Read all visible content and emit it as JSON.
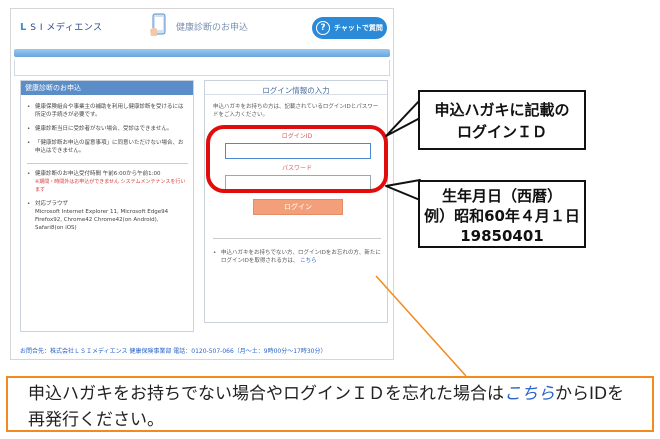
{
  "header": {
    "logo_mark": "L",
    "logo_text": "S I メディエンス",
    "page_title": "健康診断のお申込",
    "chat_icon": "?",
    "chat_label": "チャットで質問"
  },
  "left_panel": {
    "title": "健康診断のお申込",
    "items": [
      "健康保険組合や事業主の補助を利用し健康診断を受けるには所定の手続きが必要です。",
      "健康診断当日に受診者がない場合、受診はできません。",
      "「健康診断お申込の留意事項」に同意いただけない場合、お申込はできません。"
    ],
    "hours": "健康診断のお申込受付時間 午前6:00から午前1:00",
    "hours_note": "※期間・時間外はお申込ができません システムメンテナンスを行います",
    "browser_title": "対応ブラウザ",
    "browsers": "Microsoft Internet Explorer 11, Microsoft Edge94 Firefox92, Chrome42 Chrome42(on Android), Safari8(on iOS)"
  },
  "login_panel": {
    "title": "ログイン情報の入力",
    "description": "申込ハガキをお持ちの方は、記載されているログインIDとパスワードをご入力ください。",
    "login_id_label": "ログインID",
    "login_id_value": "",
    "password_label": "パスワード",
    "password_value": "",
    "login_button": "ログイン",
    "note_text": "申込ハガキをお持ちでない方、ログインIDをお忘れの方、新たにログインIDを取得される方は、",
    "note_link": "こちら"
  },
  "footer": {
    "contact": "お問合先：株式会社ＬＳＩメディエンス 健康保険事業部 電話：0120-507-066（月〜土：9時00分〜17時30分）"
  },
  "callouts": {
    "login_id": [
      "申込ハガキに記載の",
      "ログインＩＤ"
    ],
    "password": [
      "生年月日（西暦）",
      "例）昭和60年４月１日",
      "19850401"
    ]
  },
  "bottom_note": {
    "text_before": "申込ハガキをお持ちでない場合やログインＩＤを忘れた場合は",
    "link": "こちら",
    "text_after": "からIDを",
    "line2": "再発行ください。"
  },
  "colors": {
    "accent_blue": "#2a8ad8",
    "highlight_red": "#e10c0c",
    "note_orange": "#f28a1e",
    "login_button": "#f3a07a"
  }
}
